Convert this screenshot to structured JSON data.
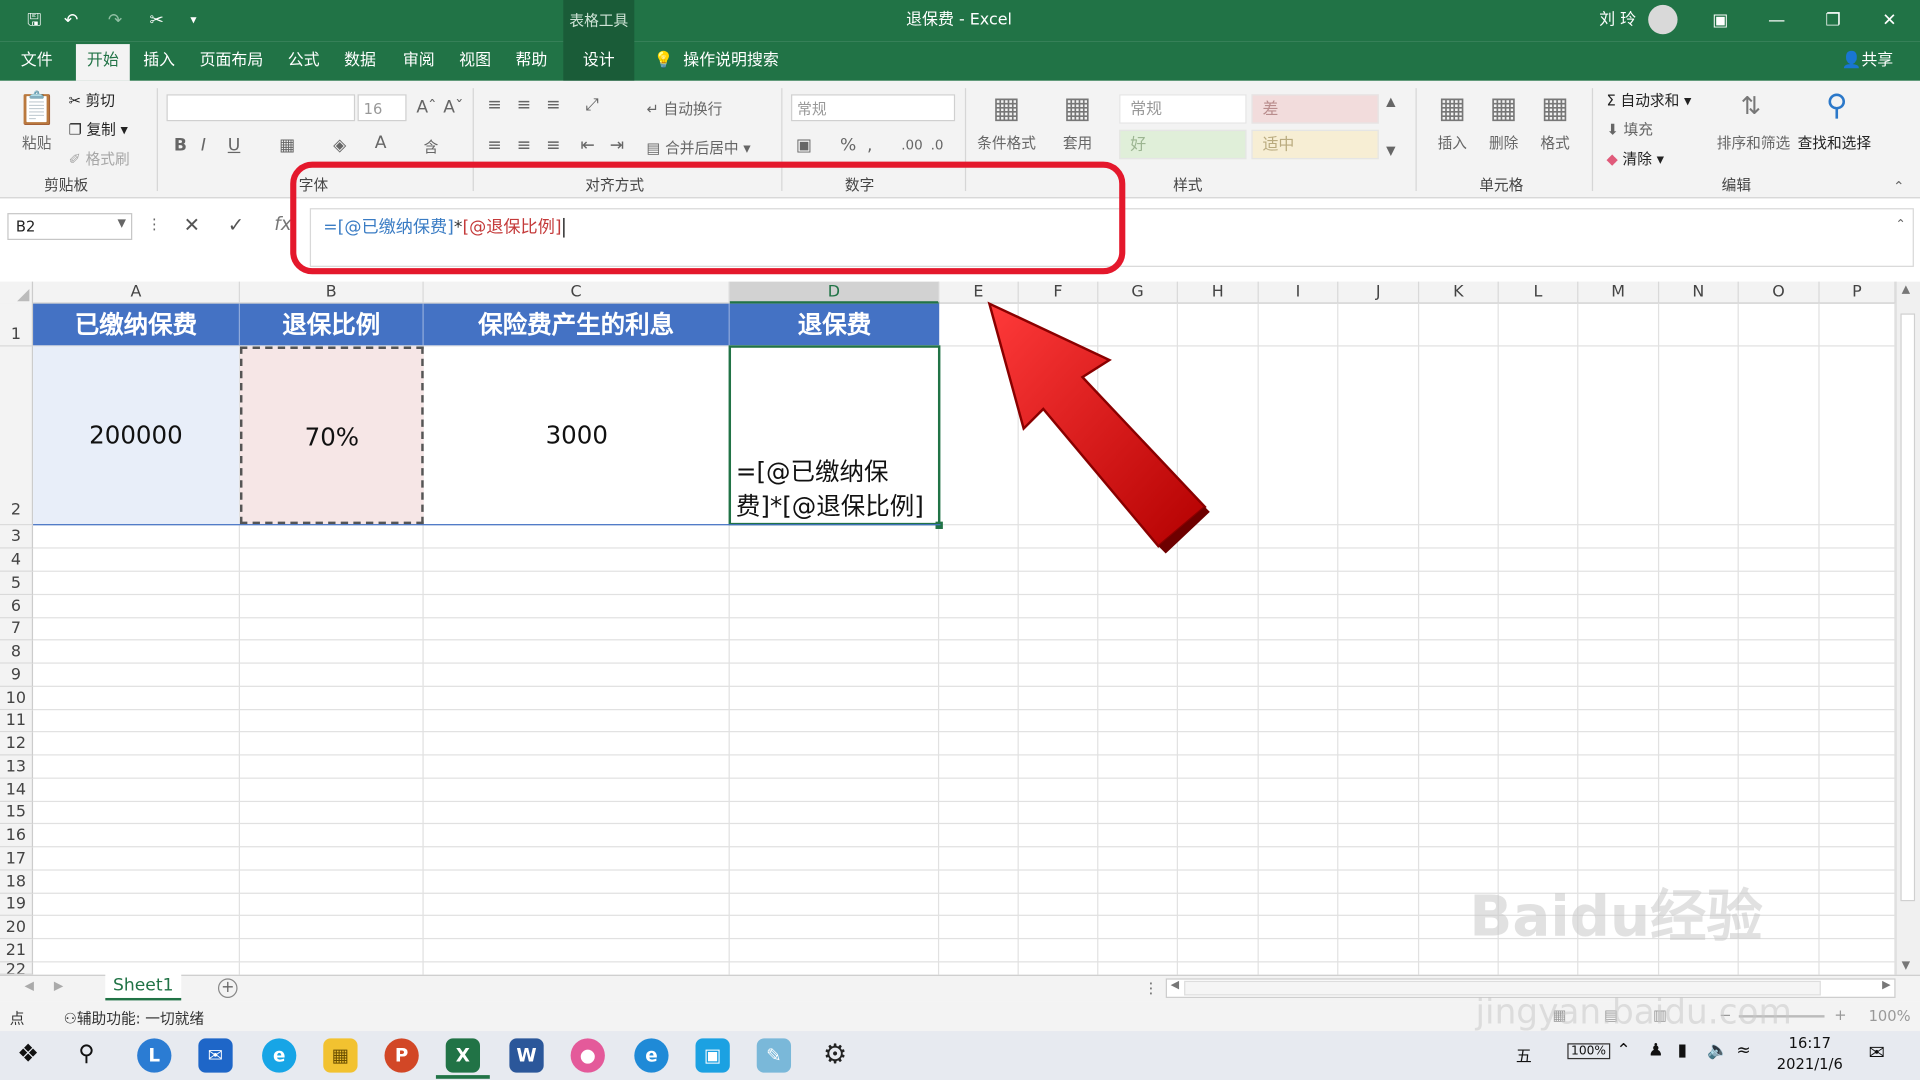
{
  "window": {
    "title": "退保费 - Excel",
    "context_tool": "表格工具",
    "user": "刘 玲",
    "buttons": [
      "ribbon-display-icon",
      "minimize-icon",
      "restore-icon",
      "close-icon"
    ]
  },
  "ribbon_tabs": [
    "文件",
    "开始",
    "插入",
    "页面布局",
    "公式",
    "数据",
    "审阅",
    "视图",
    "帮助",
    "设计"
  ],
  "active_tab": "开始",
  "tell_me": "操作说明搜索",
  "share": "共享",
  "clipboard": {
    "paste": "粘贴",
    "cut": "剪切",
    "copy": "复制",
    "format_painter": "格式刷",
    "label": "剪贴板"
  },
  "font": {
    "size": "16",
    "label": "字体"
  },
  "alignment": {
    "wrap": "自动换行",
    "merge": "合并后居中",
    "label": "对齐方式"
  },
  "number": {
    "format": "常规",
    "label": "数字"
  },
  "styles": {
    "conditional": "条件格式",
    "table": "套用",
    "normal": "常规",
    "bad": "差",
    "good": "好",
    "neutral": "适中",
    "label": "样式"
  },
  "cells": {
    "insert": "插入",
    "delete": "删除",
    "format": "格式",
    "label": "单元格"
  },
  "editing": {
    "autosum": "自动求和",
    "fill": "填充",
    "clear": "清除",
    "sort": "排序和筛选",
    "find": "查找和选择",
    "label": "编辑"
  },
  "formula_bar": {
    "name_box": "B2",
    "fx": "fx",
    "formula_parts": [
      "=[@已缴纳保费]",
      "*",
      "[@退保比例]"
    ]
  },
  "grid": {
    "columns": [
      "A",
      "B",
      "C",
      "D",
      "E",
      "F",
      "G",
      "H",
      "I",
      "J",
      "K",
      "L",
      "M",
      "N",
      "O",
      "P"
    ],
    "rows": [
      "1",
      "2",
      "3",
      "4",
      "5",
      "6",
      "7",
      "8",
      "9",
      "10",
      "11",
      "12",
      "13",
      "14",
      "15",
      "16",
      "17",
      "18",
      "19",
      "20",
      "21",
      "22"
    ],
    "headers": [
      "已缴纳保费",
      "退保比例",
      "保险费产生的利息",
      "退保费"
    ],
    "values": [
      "200000",
      "70%",
      "3000"
    ],
    "d2_text": "=[@已缴纳保\n费]*[@退保比例]"
  },
  "sheet_tab": "Sheet1",
  "status": {
    "mode": "点",
    "accessibility": "辅助功能: 一切就绪",
    "zoom": "100%"
  },
  "taskbar": {
    "time": "16:17",
    "date": "2021/1/6",
    "ime": "五",
    "battery": "100%"
  },
  "watermark": {
    "text": "Baidu经验",
    "url": "jingyan.baidu.com"
  },
  "colors": {
    "excel_green": "#217346",
    "header_blue": "#4472c4",
    "highlight_red": "#e4182c"
  }
}
